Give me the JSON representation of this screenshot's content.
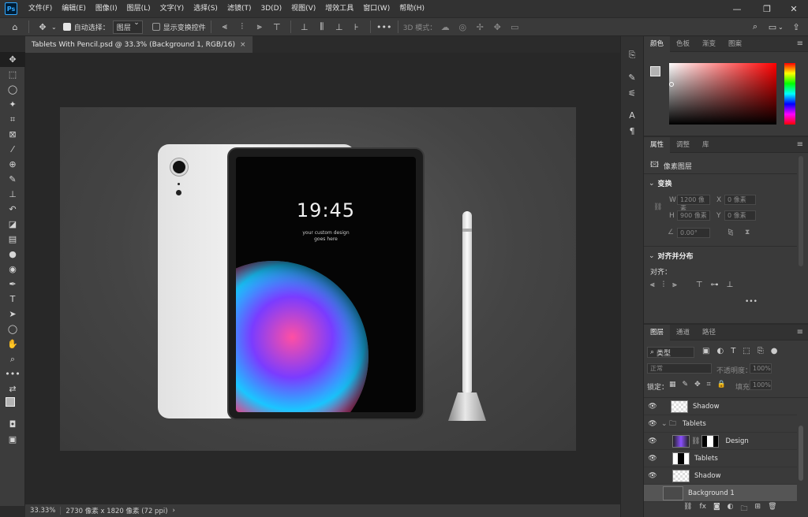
{
  "menubar": {
    "app_icon": "Ps",
    "items": [
      "文件(F)",
      "编辑(E)",
      "图像(I)",
      "图层(L)",
      "文字(Y)",
      "选择(S)",
      "滤镜(T)",
      "3D(D)",
      "视图(V)",
      "增效工具",
      "窗口(W)",
      "帮助(H)"
    ],
    "controls": {
      "minimize": "—",
      "restore": "❐",
      "close": "✕"
    }
  },
  "options": {
    "auto_select_label": "自动选择：",
    "auto_select_value": "图层",
    "show_transform_label": "显示变换控件",
    "mode_3d_label": "3D 模式："
  },
  "document": {
    "tab_title": "Tablets With Pencil.psd @ 33.3% (Background 1, RGB/16)",
    "tab_close": "×",
    "screen_time": "19:45",
    "screen_caption_line1": "your custom design",
    "screen_caption_line2": "goes here"
  },
  "status": {
    "zoom": "33.33%",
    "doc_size": "2730 像素 x 1820 像素 (72 ppi)",
    "arrow": "›"
  },
  "color_panel": {
    "tabs": [
      "颜色",
      "色板",
      "渐变",
      "图案"
    ]
  },
  "properties_panel": {
    "tabs": [
      "属性",
      "调整",
      "库"
    ],
    "layer_type": "像素图层",
    "transform_title": "变换",
    "w_label": "W",
    "w_value": "1200 像素",
    "x_label": "X",
    "x_value": "0 像素",
    "h_label": "H",
    "h_value": "900 像素",
    "y_label": "Y",
    "y_value": "0 像素",
    "angle_value": "0.00°",
    "align_title": "对齐并分布",
    "align_label": "对齐：",
    "more": "•••"
  },
  "layers_panel": {
    "tabs": [
      "图层",
      "通道",
      "路径"
    ],
    "filter_kind": "类型",
    "blend_mode": "正常",
    "opacity_label": "不透明度：",
    "opacity_value": "100%",
    "lock_label": "锁定：",
    "fill_label": "填充：",
    "fill_value": "100%",
    "layers": [
      {
        "name": "Shadow"
      },
      {
        "name": "Tablets"
      },
      {
        "name": "Design"
      },
      {
        "name": "Tablets"
      },
      {
        "name": "Shadow"
      },
      {
        "name": "Background 1"
      }
    ]
  },
  "colors": {
    "accent": "#31a8ff",
    "canvas": "#282828",
    "panel": "#3a3a3a"
  }
}
